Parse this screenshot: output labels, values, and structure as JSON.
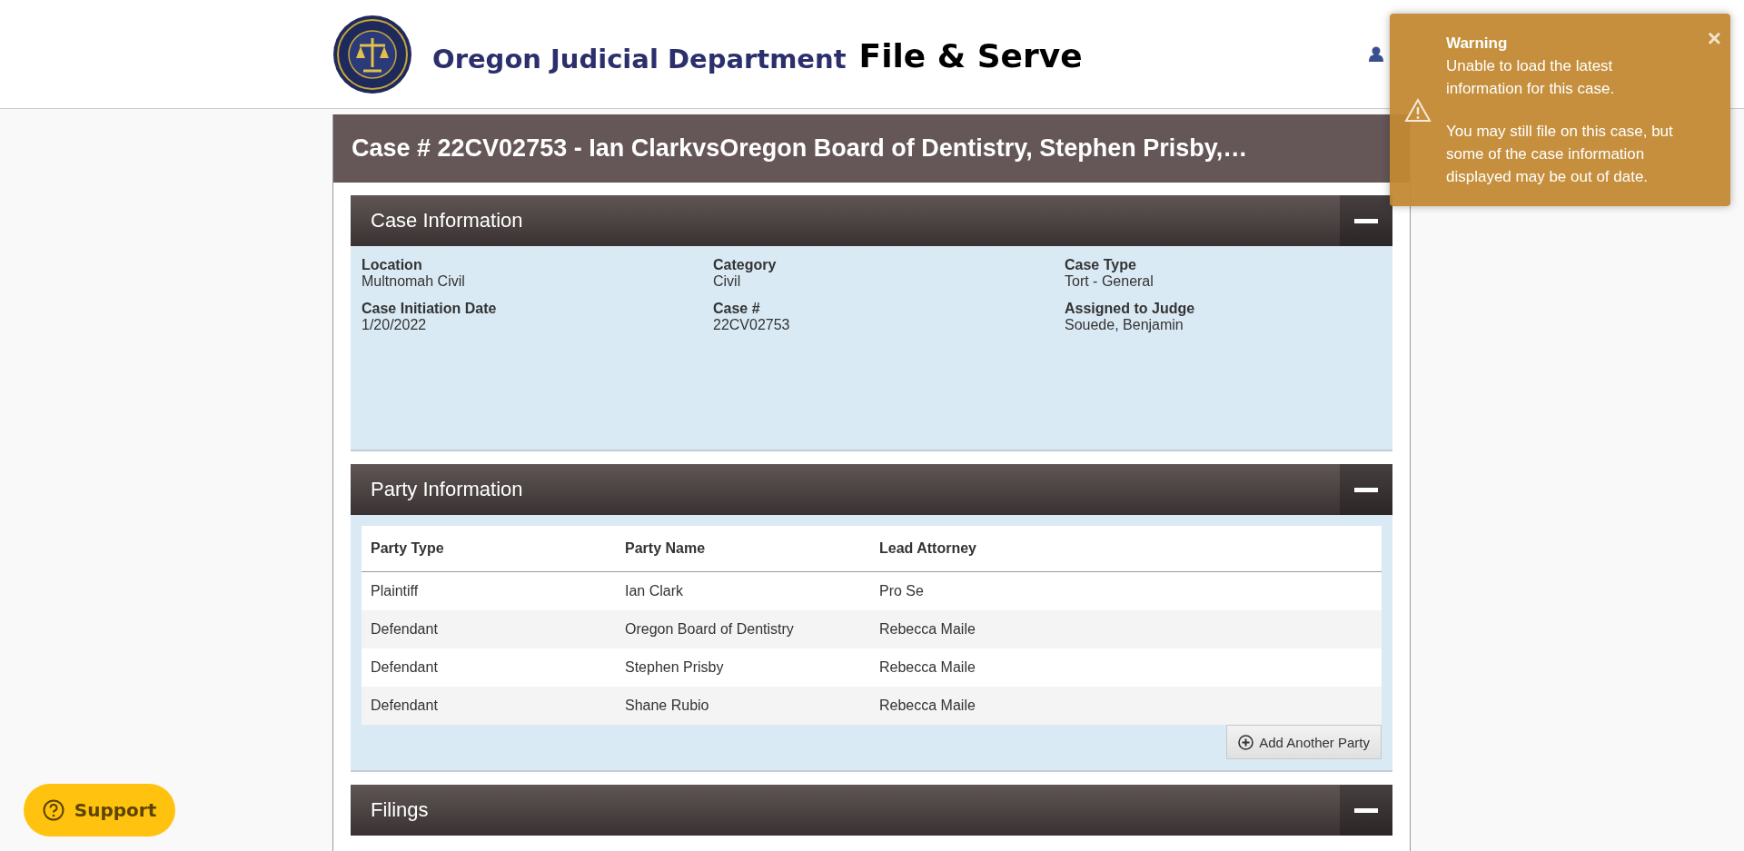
{
  "header": {
    "brand": "Oregon Judicial Department",
    "product": "File & Serve"
  },
  "toast": {
    "title": "Warning",
    "lines": [
      "Unable to load the latest information for this case.",
      "You may still file on this case, but some of the case information displayed may be out of date."
    ],
    "close": "×"
  },
  "case_title": "Case # 22CV02753 - Ian ClarkvsOregon Board of Dentistry, Stephen Prisby,…",
  "case_information": {
    "title": "Case Information",
    "expanded": true,
    "fields": [
      {
        "label": "Location",
        "value": "Multnomah Civil"
      },
      {
        "label": "Category",
        "value": "Civil"
      },
      {
        "label": "Case Type",
        "value": "Tort - General"
      },
      {
        "label": "Case Initiation Date",
        "value": "1/20/2022"
      },
      {
        "label": "Case #",
        "value": "22CV02753"
      },
      {
        "label": "Assigned to Judge",
        "value": "Souede, Benjamin"
      }
    ]
  },
  "party_information": {
    "title": "Party Information",
    "expanded": true,
    "columns": [
      "Party Type",
      "Party Name",
      "Lead Attorney"
    ],
    "rows": [
      [
        "Plaintiff",
        "Ian Clark",
        "Pro Se"
      ],
      [
        "Defendant",
        "Oregon Board of Dentistry",
        "Rebecca Maile"
      ],
      [
        "Defendant",
        "Stephen Prisby",
        "Rebecca Maile"
      ],
      [
        "Defendant",
        "Shane Rubio",
        "Rebecca Maile"
      ]
    ],
    "add_button": "Add Another Party"
  },
  "filings": {
    "title": "Filings",
    "expanded": true
  },
  "support_button": "Support"
}
